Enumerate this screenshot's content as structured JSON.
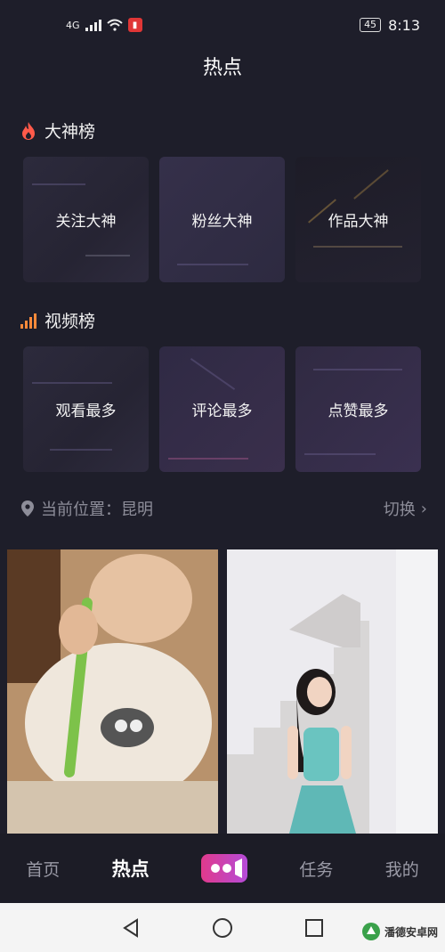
{
  "status": {
    "network": "4G",
    "battery": "45",
    "time": "8:13"
  },
  "page": {
    "title": "热点"
  },
  "gods": {
    "title": "大神榜",
    "cards": [
      "关注大神",
      "粉丝大神",
      "作品大神"
    ]
  },
  "videos": {
    "title": "视频榜",
    "cards": [
      "观看最多",
      "评论最多",
      "点赞最多"
    ]
  },
  "location": {
    "label": "当前位置：昆明",
    "switch": "切换"
  },
  "nav": {
    "items": [
      "首页",
      "热点",
      "任务",
      "我的"
    ],
    "active": "热点"
  },
  "watermark": {
    "text": "潘德安卓网"
  },
  "colors": {
    "fire": "#ff5a4a",
    "bars": "#ff8a3a",
    "camera_start": "#e03a8c",
    "camera_end": "#b54bd8"
  }
}
